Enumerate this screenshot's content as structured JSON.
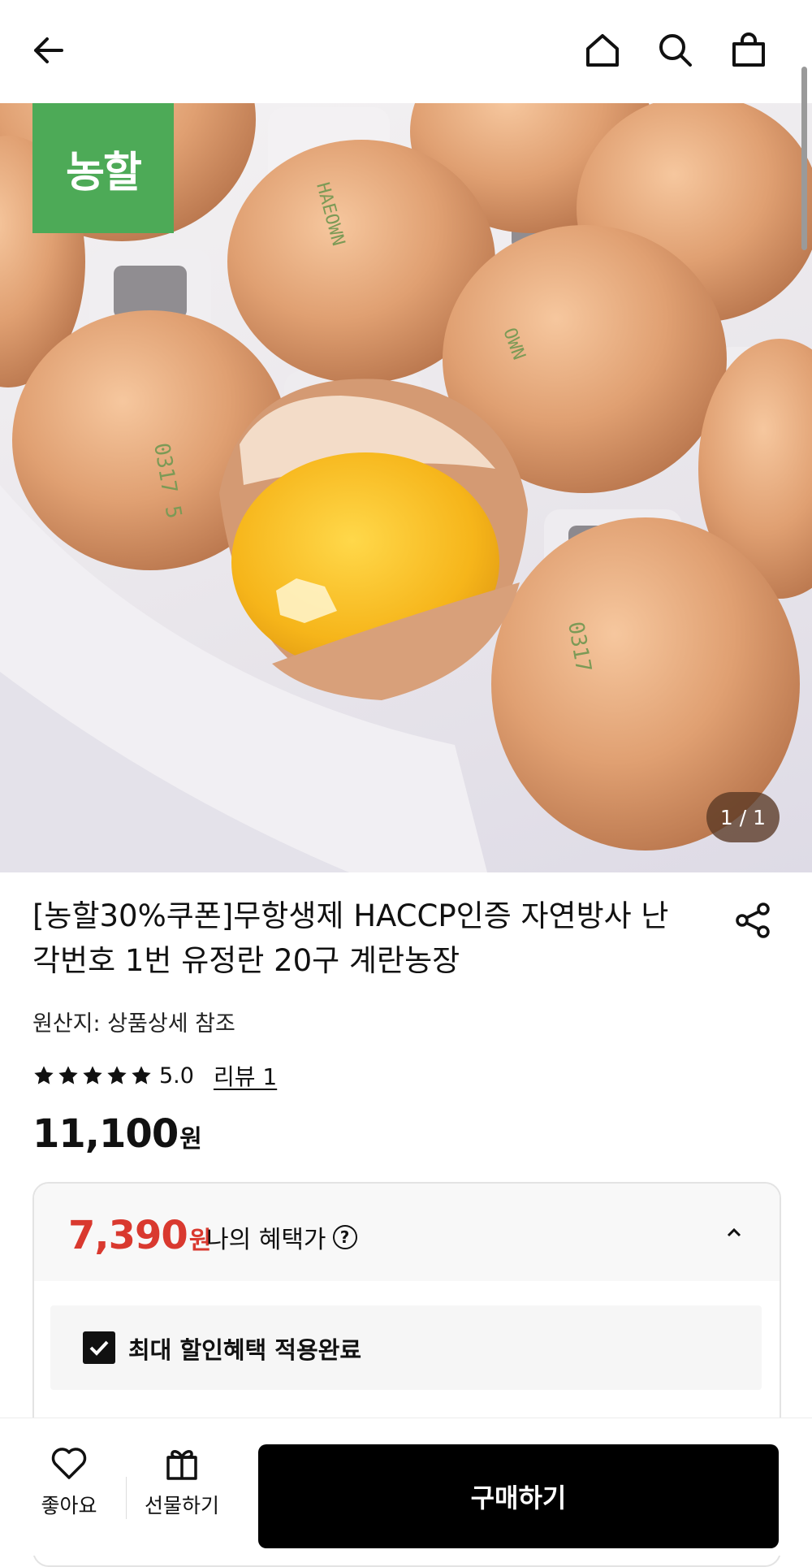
{
  "header": {
    "back_icon": "arrow-left-icon",
    "home_icon": "home-icon",
    "search_icon": "search-icon",
    "cart_icon": "shopping-bag-icon"
  },
  "hero": {
    "brand_logo_text": "농할",
    "image_counter": "1 / 1",
    "brand_color": "#4daa57"
  },
  "product": {
    "title": "[농할30%쿠폰]무항생제 HACCP인증 자연방사 난각번호 1번 유정란 20구 계란농장",
    "origin": "원산지: 상품상세 참조",
    "rating_value": 5.0,
    "rating_text": "5.0",
    "review_link": "리뷰 1",
    "price": "11,100",
    "currency": "원"
  },
  "benefit": {
    "price": "7,390",
    "currency": "원",
    "label": "나의 혜택가",
    "help_icon": "?",
    "accent_color": "#d9392f",
    "applied_text": "최대 할인혜택 적용완료"
  },
  "bottom_bar": {
    "like_label": "좋아요",
    "gift_label": "선물하기",
    "buy_label": "구매하기"
  }
}
